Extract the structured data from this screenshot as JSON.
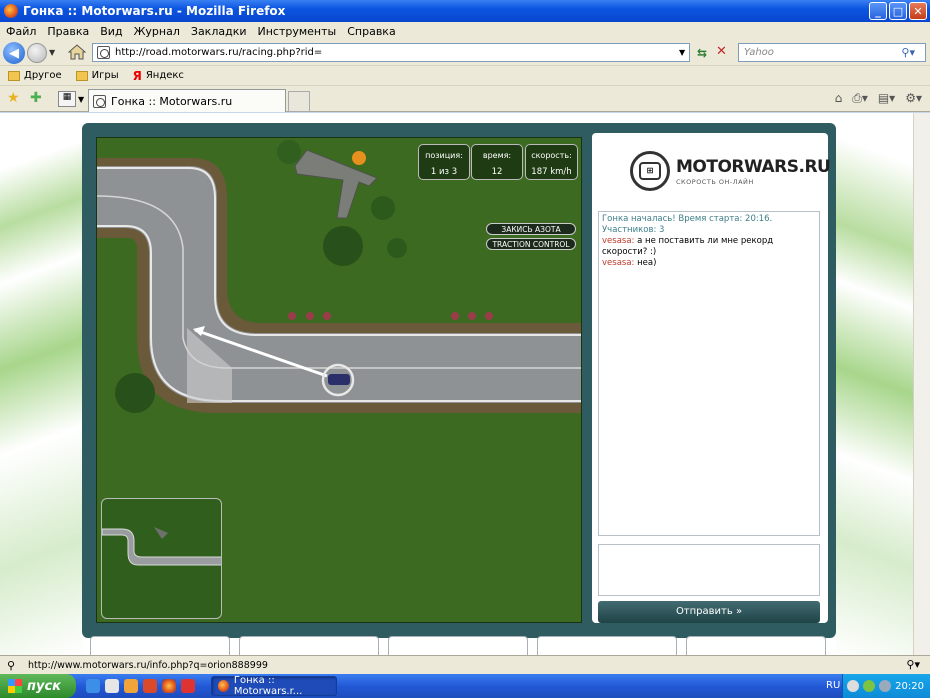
{
  "window": {
    "title": "Гонка :: Motorwars.ru - Mozilla Firefox"
  },
  "menu": [
    "Файл",
    "Правка",
    "Вид",
    "Журнал",
    "Закладки",
    "Инструменты",
    "Справка"
  ],
  "navigation": {
    "url": "http://road.motorwars.ru/racing.php?rid=",
    "search_placeholder": "Yahoo"
  },
  "bookmarks": [
    "Другое",
    "Игры",
    "Яндекс"
  ],
  "tab": {
    "title": "Гонка :: Motorwars.ru"
  },
  "game": {
    "hud": [
      {
        "label": "позиция:",
        "value": "1 из 3"
      },
      {
        "label": "время:",
        "value": "12"
      },
      {
        "label": "скорость:",
        "value": "187 km/h"
      }
    ],
    "buttons": {
      "nitro": "ЗАКИСЬ АЗОТА",
      "traction": "TRACTION CONTROL"
    }
  },
  "chat": {
    "logo_name": "MOTORWARS.RU",
    "logo_slogan": "СКОРОСТЬ ОН-ЛАЙН",
    "system_message": "Гонка началась! Время старта: 20:16. Участников: 3",
    "messages": [
      {
        "nick": "vesasa:",
        "text": "а не поставить ли мне рекорд скорости? :)"
      },
      {
        "nick": "vesasa:",
        "text": "неа)"
      }
    ],
    "send_label": "Отправить »"
  },
  "status": {
    "text": "http://www.motorwars.ru/info.php?q=orion888999"
  },
  "taskbar": {
    "start_label": "пуск",
    "task_label": "Гонка :: Motorwars.r...",
    "lang": "RU",
    "clock": "20:20"
  },
  "colors": {
    "frame": "#2e5c60",
    "grass": "#3f6c22",
    "road": "#8f9294",
    "accent": "#3c7f88"
  }
}
